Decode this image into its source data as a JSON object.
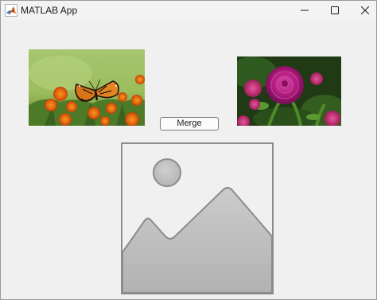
{
  "window": {
    "title": "MATLAB App",
    "icon": "matlab-logo-icon",
    "controls": [
      "minimize-icon",
      "maximize-icon",
      "close-icon"
    ]
  },
  "images": {
    "left": "butterfly-on-marigolds-photo",
    "right": "pink-zinnia-flower-photo",
    "result": "image-placeholder-icon"
  },
  "buttons": {
    "merge_label": "Merge"
  },
  "colors": {
    "window_bg": "#f0f0f0",
    "placeholder_border": "#8c8c8c",
    "placeholder_fill": "#c8c8c8"
  }
}
